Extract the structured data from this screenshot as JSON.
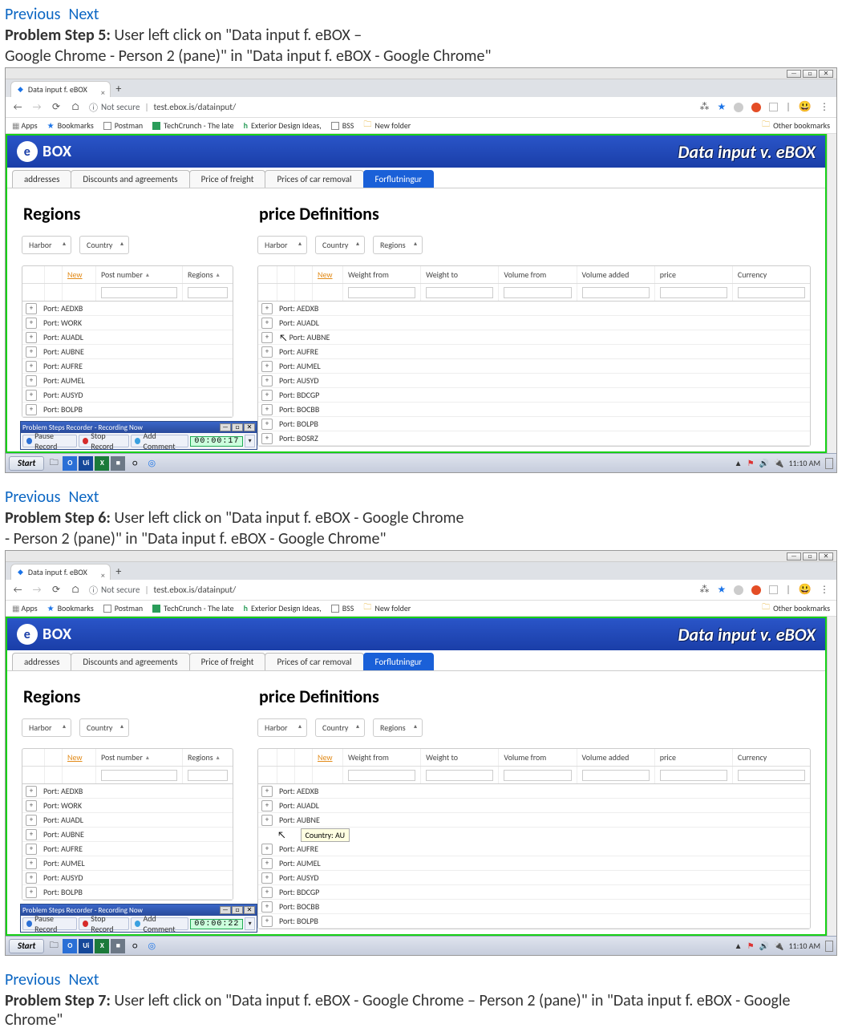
{
  "nav": {
    "prev": "Previous",
    "next": "Next"
  },
  "steps": {
    "s5": {
      "label": "Problem Step 5:",
      "text1": "User left click on \"Data input f. eBOX –",
      "text2": "Google Chrome - Person 2 (pane)\" in \"Data input f. eBOX - Google Chrome\""
    },
    "s6": {
      "label": "Problem Step 6:",
      "text1": "User left click on \"Data input f. eBOX - Google Chrome",
      "text2": "- Person 2 (pane)\" in \"Data input f. eBOX - Google Chrome\""
    },
    "s7": {
      "label": "Problem Step 7:",
      "text1": "User left click on \"Data input f. eBOX - Google Chrome – Person 2 (pane)\" in \"Data input f. eBOX - Google Chrome\""
    }
  },
  "browser": {
    "tabTitle": "Data input f. eBOX",
    "notSecure": "Not secure",
    "url": "test.ebox.is/datainput/",
    "apps": "Apps",
    "bookmarks": [
      "Bookmarks",
      "Postman",
      "TechCrunch - The late",
      "Exterior Design Ideas,",
      "BSS",
      "New folder"
    ],
    "otherBm": "Other bookmarks"
  },
  "app": {
    "logo": "BOX",
    "logoE": "e",
    "title": "Data input v. eBOX",
    "tabs": [
      "addresses",
      "Discounts and agreements",
      "Price of freight",
      "Prices of car removal",
      "Forflutningur"
    ],
    "left": {
      "heading": "Regions",
      "filters": [
        "Harbor",
        "Country"
      ],
      "newLabel": "New",
      "cols": [
        "Post number",
        "Regions"
      ],
      "rows": [
        "Port: AEDXB",
        "Port: WORK",
        "Port: AUADL",
        "Port: AUBNE",
        "Port: AUFRE",
        "Port: AUMEL",
        "Port: AUSYD",
        "Port: BOLPB"
      ]
    },
    "right": {
      "heading": "price Definitions",
      "filters": [
        "Harbor",
        "Country",
        "Regions"
      ],
      "newLabel": "New",
      "cols": [
        "Weight from",
        "Weight to",
        "Volume from",
        "Volume added",
        "price",
        "Currency"
      ],
      "rows": [
        "Port: AEDXB",
        "Port: AUADL",
        "Port: AUBNE",
        "Port: AUFRE",
        "Port: AUMEL",
        "Port: AUSYD",
        "Port: BDCGP",
        "Port: BOCBB",
        "Port: BOLPB",
        "Port: BOSRZ"
      ]
    },
    "tooltip6": "Country: AU"
  },
  "psr": {
    "title": "Problem Steps Recorder - Recording Now",
    "pause": "Pause Record",
    "stop": "Stop Record",
    "comment": "Add Comment",
    "time5": "00:00:17",
    "time6": "00:00:22"
  },
  "taskbar": {
    "start": "Start",
    "time": "11:10 AM"
  }
}
